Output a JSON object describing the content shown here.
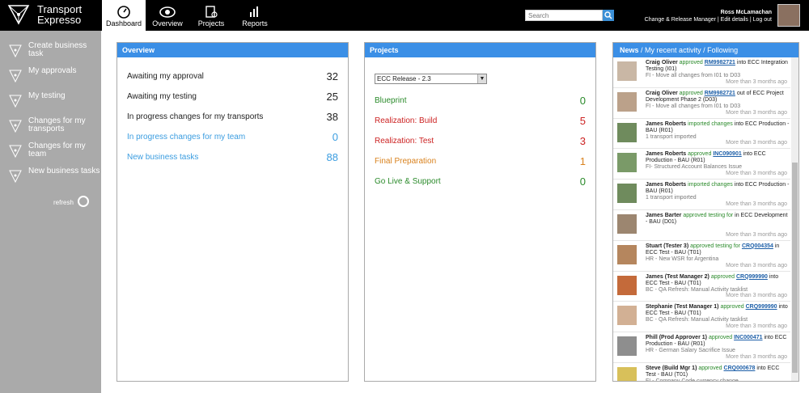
{
  "app": {
    "title_line1": "Transport",
    "title_line2": "Expresso"
  },
  "nav": [
    {
      "label": "Dashboard"
    },
    {
      "label": "Overview"
    },
    {
      "label": "Projects"
    },
    {
      "label": "Reports"
    }
  ],
  "search": {
    "placeholder": "Search"
  },
  "user": {
    "name": "Ross McLamachan",
    "role_links": "Change & Release Manager | Edit details | Log out"
  },
  "sidebar": [
    {
      "label": "Create business task"
    },
    {
      "label": "My approvals"
    },
    {
      "label": "My testing"
    },
    {
      "label": "Changes for my transports"
    },
    {
      "label": "Changes for my team"
    },
    {
      "label": "New business tasks"
    }
  ],
  "refresh_label": "refresh",
  "overview": {
    "title": "Overview",
    "rows": [
      {
        "label": "Awaiting my approval",
        "count": "32"
      },
      {
        "label": "Awaiting my testing",
        "count": "25"
      },
      {
        "label": "In progress changes for my transports",
        "count": "38"
      },
      {
        "label": "In progress changes for my team",
        "count": "0"
      },
      {
        "label": "New business tasks",
        "count": "88"
      }
    ]
  },
  "projects": {
    "title": "Projects",
    "selected": "ECC Release - 2.3",
    "rows": [
      {
        "label": "Blueprint",
        "count": "0",
        "color": "#2a8a2a"
      },
      {
        "label": "Realization: Build",
        "count": "5",
        "color": "#cc2222"
      },
      {
        "label": "Realization: Test",
        "count": "3",
        "color": "#cc2222"
      },
      {
        "label": "Final Preparation",
        "count": "1",
        "color": "#d9821e"
      },
      {
        "label": "Go Live & Support",
        "count": "0",
        "color": "#2a8a2a"
      }
    ]
  },
  "news": {
    "tabs": [
      "News",
      "My recent activity",
      "Following"
    ],
    "items": [
      {
        "who": "Craig Oliver",
        "act": "approved",
        "ref": "RM9982721",
        "rest": "into ECC Integration Testing (I01)",
        "sub": "FI - Move all changes from I01 to D03",
        "time": "More than 3 months ago"
      },
      {
        "who": "Craig Oliver",
        "act": "approved",
        "ref": "RM9982721",
        "rest": "out of ECC Project Development Phase 2 (D03)",
        "sub": "FI - Move all changes from I01 to D03",
        "time": "More than 3 months ago"
      },
      {
        "who": "James Roberts",
        "act": "imported changes",
        "ref": "",
        "rest": "into ECC Production - BAU (R01)",
        "sub": "1 transport imported",
        "time": "More than 3 months ago"
      },
      {
        "who": "James Roberts",
        "act": "approved",
        "ref": "INC090901",
        "rest": "into ECC Production - BAU (R01)",
        "sub": "FI- Structured Account Balances Issue",
        "time": "More than 3 months ago"
      },
      {
        "who": "James Roberts",
        "act": "imported changes",
        "ref": "",
        "rest": "into ECC Production - BAU (R01)",
        "sub": "1 transport imported",
        "time": "More than 3 months ago"
      },
      {
        "who": "James Barter",
        "act": "approved testing for",
        "ref": "",
        "rest": "in ECC Development - BAU (D01)",
        "sub": "",
        "time": "More than 3 months ago"
      },
      {
        "who": "Stuart (Tester 3)",
        "act": "approved testing for",
        "ref": "CRQ004354",
        "rest": "in ECC Test - BAU (T01)",
        "sub": "HR - New WSR for Argentina",
        "time": "More than 3 months ago"
      },
      {
        "who": "James (Test Manager 2)",
        "act": "approved",
        "ref": "CRQ999990",
        "rest": "into ECC Test - BAU (T01)",
        "sub": "BC - QA Refresh: Manual Activity tasklist",
        "time": "More than 3 months ago"
      },
      {
        "who": "Stephanie (Test Manager 1)",
        "act": "approved",
        "ref": "CRQ999990",
        "rest": "into ECC Test - BAU (T01)",
        "sub": "BC - QA Refresh: Manual Activity tasklist",
        "time": "More than 3 months ago"
      },
      {
        "who": "Phill (Prod Approver 1)",
        "act": "approved",
        "ref": "INC000471",
        "rest": "into ECC Production - BAU (R01)",
        "sub": "HR - German Salary Sacrifice Issue",
        "time": "More than 3 months ago"
      },
      {
        "who": "Steve (Build Mgr 1)",
        "act": "approved",
        "ref": "CRQ000678",
        "rest": "into ECC Test - BAU (T01)",
        "sub": "FI - Company Code currency change",
        "time": ""
      }
    ]
  }
}
